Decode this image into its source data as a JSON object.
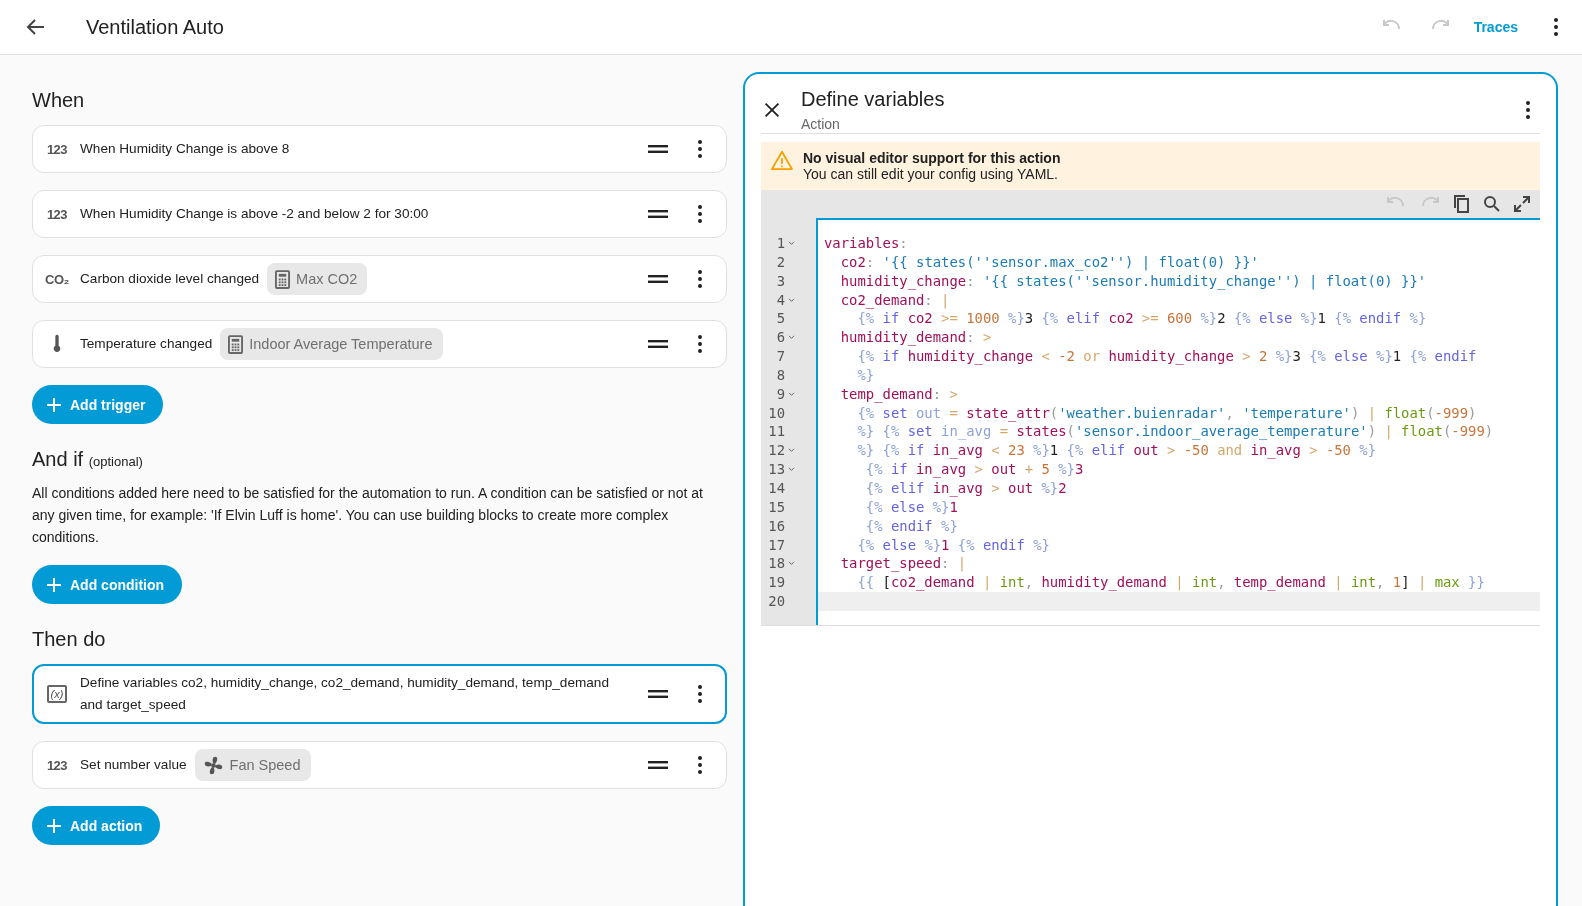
{
  "header": {
    "title": "Ventilation Auto",
    "undo_disabled": true,
    "redo_disabled": true,
    "traces_link": "Traces"
  },
  "when": {
    "heading": "When",
    "items": [
      {
        "kind": "numeric",
        "icon_text": "123",
        "text": "When Humidity Change is above 8",
        "selected": false
      },
      {
        "kind": "numeric",
        "icon_text": "123",
        "text": "When Humidity Change is above -2 and below 2 for 30:00",
        "selected": false
      },
      {
        "kind": "co2",
        "icon_text": "CO₂",
        "text": "Carbon dioxide level changed",
        "selected": false,
        "chip": {
          "kind": "calculator",
          "label": "Max CO2"
        }
      },
      {
        "kind": "thermometer",
        "text": "Temperature changed",
        "selected": false,
        "chip": {
          "kind": "calculator",
          "label": "Indoor Average Temperature"
        }
      }
    ],
    "add_button": "Add trigger"
  },
  "and_if": {
    "heading": "And if",
    "note": "(optional)",
    "description": "All conditions added here need to be satisfied for the automation to run. A condition can be satisfied or not at any given time, for example: 'If Elvin Luff is home'. You can use building blocks to create more complex conditions.",
    "add_button": "Add condition"
  },
  "then_do": {
    "heading": "Then do",
    "items": [
      {
        "kind": "variables",
        "icon_text": "(x)",
        "text": "Define variables co2, humidity_change, co2_demand, humidity_demand, temp_demand and target_speed",
        "selected": true
      },
      {
        "kind": "numeric",
        "icon_text": "123",
        "text": "Set number value",
        "selected": false,
        "chip": {
          "kind": "fan",
          "label": "Fan Speed"
        }
      }
    ],
    "add_button": "Add action"
  },
  "panel": {
    "title": "Define variables",
    "subtitle": "Action",
    "warning": {
      "title": "No visual editor support for this action",
      "text": "You can still edit your config using YAML."
    },
    "editor": {
      "undo_disabled": true,
      "redo_disabled": true,
      "lines": [
        {
          "number": "1",
          "foldable": true,
          "active": false,
          "tokens": [
            {
              "kind": "key",
              "text": "variables"
            },
            {
              "kind": "punct",
              "text": ":"
            }
          ]
        },
        {
          "number": "2",
          "foldable": false,
          "active": false,
          "tokens": [
            {
              "kind": "key",
              "text": "  co2"
            },
            {
              "kind": "punct",
              "text": ": "
            },
            {
              "kind": "string",
              "text": "'{{ states(''sensor.max_co2'') | float(0) }}'"
            }
          ]
        },
        {
          "number": "3",
          "foldable": false,
          "active": false,
          "tokens": [
            {
              "kind": "key",
              "text": "  humidity_change"
            },
            {
              "kind": "punct",
              "text": ": "
            },
            {
              "kind": "string",
              "text": "'{{ states(''sensor.humidity_change'') | float(0) }}'"
            }
          ]
        },
        {
          "number": "4",
          "foldable": true,
          "active": false,
          "tokens": [
            {
              "kind": "key",
              "text": "  co2_demand"
            },
            {
              "kind": "punct",
              "text": ": "
            },
            {
              "kind": "op",
              "text": "|"
            }
          ]
        },
        {
          "number": "5",
          "foldable": false,
          "active": false,
          "tokens": [
            {
              "kind": "delim",
              "text": "    {% "
            },
            {
              "kind": "keyword",
              "text": "if "
            },
            {
              "kind": "key",
              "text": "co2 "
            },
            {
              "kind": "op",
              "text": ">= "
            },
            {
              "kind": "number",
              "text": "1000 "
            },
            {
              "kind": "delim",
              "text": "%}"
            },
            {
              "kind": "plain",
              "text": "3 "
            },
            {
              "kind": "delim",
              "text": "{% "
            },
            {
              "kind": "keyword",
              "text": "elif "
            },
            {
              "kind": "key",
              "text": "co2 "
            },
            {
              "kind": "op",
              "text": ">= "
            },
            {
              "kind": "number",
              "text": "600 "
            },
            {
              "kind": "delim",
              "text": "%}"
            },
            {
              "kind": "plain",
              "text": "2 "
            },
            {
              "kind": "delim",
              "text": "{% "
            },
            {
              "kind": "keyword",
              "text": "else "
            },
            {
              "kind": "delim",
              "text": "%}"
            },
            {
              "kind": "plain",
              "text": "1 "
            },
            {
              "kind": "delim",
              "text": "{% "
            },
            {
              "kind": "keyword",
              "text": "endif "
            },
            {
              "kind": "delim",
              "text": "%}"
            }
          ]
        },
        {
          "number": "6",
          "foldable": true,
          "active": false,
          "tokens": [
            {
              "kind": "key",
              "text": "  humidity_demand"
            },
            {
              "kind": "punct",
              "text": ": "
            },
            {
              "kind": "op",
              "text": ">"
            }
          ]
        },
        {
          "number": "7",
          "foldable": false,
          "active": false,
          "tokens": [
            {
              "kind": "delim",
              "text": "    {% "
            },
            {
              "kind": "keyword",
              "text": "if "
            },
            {
              "kind": "key",
              "text": "humidity_change "
            },
            {
              "kind": "op",
              "text": "< "
            },
            {
              "kind": "number",
              "text": "-2 "
            },
            {
              "kind": "op",
              "text": "or "
            },
            {
              "kind": "key",
              "text": "humidity_change "
            },
            {
              "kind": "op",
              "text": "> "
            },
            {
              "kind": "number",
              "text": "2 "
            },
            {
              "kind": "delim",
              "text": "%}"
            },
            {
              "kind": "plain",
              "text": "3 "
            },
            {
              "kind": "delim",
              "text": "{% "
            },
            {
              "kind": "keyword",
              "text": "else "
            },
            {
              "kind": "delim",
              "text": "%}"
            },
            {
              "kind": "plain",
              "text": "1 "
            },
            {
              "kind": "delim",
              "text": "{% "
            },
            {
              "kind": "keyword",
              "text": "endif"
            }
          ]
        },
        {
          "number": "8",
          "foldable": false,
          "active": false,
          "tokens": [
            {
              "kind": "delim",
              "text": "    %}"
            }
          ]
        },
        {
          "number": "9",
          "foldable": true,
          "active": false,
          "tokens": [
            {
              "kind": "key",
              "text": "  temp_demand"
            },
            {
              "kind": "punct",
              "text": ": "
            },
            {
              "kind": "op",
              "text": ">"
            }
          ]
        },
        {
          "number": "10",
          "foldable": false,
          "active": false,
          "tokens": [
            {
              "kind": "delim",
              "text": "    {% "
            },
            {
              "kind": "keyword",
              "text": "set "
            },
            {
              "kind": "delim",
              "text": "out "
            },
            {
              "kind": "op",
              "text": "= "
            },
            {
              "kind": "key",
              "text": "state_attr"
            },
            {
              "kind": "punct",
              "text": "("
            },
            {
              "kind": "string",
              "text": "'weather.buienradar'"
            },
            {
              "kind": "punct",
              "text": ", "
            },
            {
              "kind": "string",
              "text": "'temperature'"
            },
            {
              "kind": "punct",
              "text": ") "
            },
            {
              "kind": "op",
              "text": "| "
            },
            {
              "kind": "filter",
              "text": "float"
            },
            {
              "kind": "punct",
              "text": "("
            },
            {
              "kind": "number",
              "text": "-999"
            },
            {
              "kind": "punct",
              "text": ")"
            }
          ]
        },
        {
          "number": "11",
          "foldable": false,
          "active": false,
          "tokens": [
            {
              "kind": "delim",
              "text": "    %} {% "
            },
            {
              "kind": "keyword",
              "text": "set "
            },
            {
              "kind": "delim",
              "text": "in_avg "
            },
            {
              "kind": "op",
              "text": "= "
            },
            {
              "kind": "key",
              "text": "states"
            },
            {
              "kind": "punct",
              "text": "("
            },
            {
              "kind": "string",
              "text": "'sensor.indoor_average_temperature'"
            },
            {
              "kind": "punct",
              "text": ") "
            },
            {
              "kind": "op",
              "text": "| "
            },
            {
              "kind": "filter",
              "text": "float"
            },
            {
              "kind": "punct",
              "text": "("
            },
            {
              "kind": "number",
              "text": "-999"
            },
            {
              "kind": "punct",
              "text": ")"
            }
          ]
        },
        {
          "number": "12",
          "foldable": true,
          "active": false,
          "tokens": [
            {
              "kind": "delim",
              "text": "    %} {% "
            },
            {
              "kind": "keyword",
              "text": "if "
            },
            {
              "kind": "key",
              "text": "in_avg "
            },
            {
              "kind": "op",
              "text": "< "
            },
            {
              "kind": "number",
              "text": "23 "
            },
            {
              "kind": "delim",
              "text": "%}"
            },
            {
              "kind": "plain",
              "text": "1 "
            },
            {
              "kind": "delim",
              "text": "{% "
            },
            {
              "kind": "keyword",
              "text": "elif "
            },
            {
              "kind": "key",
              "text": "out "
            },
            {
              "kind": "op",
              "text": "> "
            },
            {
              "kind": "number",
              "text": "-50 "
            },
            {
              "kind": "op",
              "text": "and "
            },
            {
              "kind": "key",
              "text": "in_avg "
            },
            {
              "kind": "op",
              "text": "> "
            },
            {
              "kind": "number",
              "text": "-50 "
            },
            {
              "kind": "delim",
              "text": "%}"
            }
          ]
        },
        {
          "number": "13",
          "foldable": true,
          "active": false,
          "tokens": [
            {
              "kind": "delim",
              "text": "     {% "
            },
            {
              "kind": "keyword",
              "text": "if "
            },
            {
              "kind": "key",
              "text": "in_avg "
            },
            {
              "kind": "op",
              "text": "> "
            },
            {
              "kind": "key",
              "text": "out "
            },
            {
              "kind": "op",
              "text": "+ "
            },
            {
              "kind": "number",
              "text": "5 "
            },
            {
              "kind": "delim",
              "text": "%}"
            },
            {
              "kind": "key",
              "text": "3"
            }
          ]
        },
        {
          "number": "14",
          "foldable": false,
          "active": false,
          "tokens": [
            {
              "kind": "delim",
              "text": "     {% "
            },
            {
              "kind": "keyword",
              "text": "elif "
            },
            {
              "kind": "key",
              "text": "in_avg "
            },
            {
              "kind": "op",
              "text": "> "
            },
            {
              "kind": "key",
              "text": "out "
            },
            {
              "kind": "delim",
              "text": "%}"
            },
            {
              "kind": "key",
              "text": "2"
            }
          ]
        },
        {
          "number": "15",
          "foldable": false,
          "active": false,
          "tokens": [
            {
              "kind": "delim",
              "text": "     {% "
            },
            {
              "kind": "keyword",
              "text": "else "
            },
            {
              "kind": "delim",
              "text": "%}"
            },
            {
              "kind": "key",
              "text": "1"
            }
          ]
        },
        {
          "number": "16",
          "foldable": false,
          "active": false,
          "tokens": [
            {
              "kind": "delim",
              "text": "     {% "
            },
            {
              "kind": "keyword",
              "text": "endif "
            },
            {
              "kind": "delim",
              "text": "%}"
            }
          ]
        },
        {
          "number": "17",
          "foldable": false,
          "active": false,
          "tokens": [
            {
              "kind": "delim",
              "text": "    {% "
            },
            {
              "kind": "keyword",
              "text": "else "
            },
            {
              "kind": "delim",
              "text": "%}"
            },
            {
              "kind": "key",
              "text": "1 "
            },
            {
              "kind": "delim",
              "text": "{% "
            },
            {
              "kind": "keyword",
              "text": "endif "
            },
            {
              "kind": "delim",
              "text": "%}"
            }
          ]
        },
        {
          "number": "18",
          "foldable": true,
          "active": false,
          "tokens": [
            {
              "kind": "key",
              "text": "  target_speed"
            },
            {
              "kind": "punct",
              "text": ": "
            },
            {
              "kind": "op",
              "text": "|"
            }
          ]
        },
        {
          "number": "19",
          "foldable": false,
          "active": false,
          "tokens": [
            {
              "kind": "delim",
              "text": "    {{ "
            },
            {
              "kind": "plain",
              "text": "["
            },
            {
              "kind": "key",
              "text": "co2_demand "
            },
            {
              "kind": "op",
              "text": "| "
            },
            {
              "kind": "filter",
              "text": "int"
            },
            {
              "kind": "punct",
              "text": ", "
            },
            {
              "kind": "key",
              "text": "humidity_demand "
            },
            {
              "kind": "op",
              "text": "| "
            },
            {
              "kind": "filter",
              "text": "int"
            },
            {
              "kind": "punct",
              "text": ", "
            },
            {
              "kind": "key",
              "text": "temp_demand "
            },
            {
              "kind": "op",
              "text": "| "
            },
            {
              "kind": "filter",
              "text": "int"
            },
            {
              "kind": "punct",
              "text": ", "
            },
            {
              "kind": "number",
              "text": "1"
            },
            {
              "kind": "plain",
              "text": "] "
            },
            {
              "kind": "op",
              "text": "| "
            },
            {
              "kind": "filter",
              "text": "max "
            },
            {
              "kind": "delim",
              "text": "}}"
            }
          ]
        },
        {
          "number": "20",
          "foldable": false,
          "active": true
        }
      ]
    }
  }
}
